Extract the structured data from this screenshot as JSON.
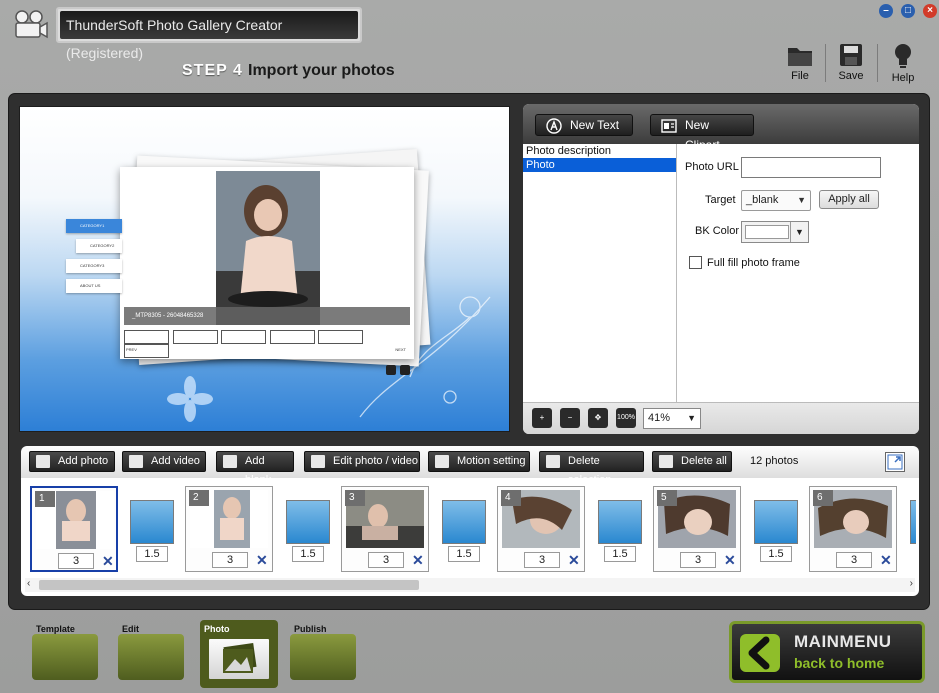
{
  "window": {
    "title": "ThunderSoft Photo Gallery Creator (Registered)",
    "controls": {
      "minimize": "minimize-icon",
      "maximize": "maximize-icon",
      "close": "close-icon"
    }
  },
  "step": {
    "label": "STEP 4",
    "title": "Import your photos"
  },
  "tools": {
    "file": "File",
    "save": "Save",
    "help": "Help"
  },
  "preview": {
    "menu": [
      "CATEGORY1",
      "CATEGORY2",
      "CATEGORY3",
      "ABOUT US"
    ],
    "caption": "_MTP8305 - 26048465328",
    "prev": "PREV",
    "next": "NEXT"
  },
  "props": {
    "new_text": "New Text",
    "new_clipart": "New Clipart",
    "list": [
      "Photo description",
      "Photo"
    ],
    "selected_index": 1,
    "photo_url_label": "Photo URL",
    "photo_url_value": "",
    "target_label": "Target",
    "target_value": "_blank",
    "apply_all": "Apply all",
    "bkcolor_label": "BK Color",
    "fullfill_label": "Full fill photo frame",
    "fullfill_checked": false,
    "zoom_value": "41%",
    "zoom_100_label": "100%"
  },
  "strip_toolbar": {
    "add_photo": "Add photo",
    "add_video": "Add video",
    "add_blank": "Add blank",
    "edit_photo_video": "Edit photo / video",
    "motion_setting": "Motion setting",
    "delete_selection": "Delete selection",
    "delete_all": "Delete all",
    "photo_count": "12 photos"
  },
  "thumbnails": [
    {
      "num": "1",
      "duration": "3",
      "transition": "1.5"
    },
    {
      "num": "2",
      "duration": "3",
      "transition": "1.5"
    },
    {
      "num": "3",
      "duration": "3",
      "transition": "1.5"
    },
    {
      "num": "4",
      "duration": "3",
      "transition": "1.5"
    },
    {
      "num": "5",
      "duration": "3",
      "transition": "1.5"
    },
    {
      "num": "6",
      "duration": "3"
    }
  ],
  "bottom_tabs": {
    "template": "Template",
    "edit": "Edit",
    "photo": "Photo",
    "publish": "Publish",
    "active": "photo"
  },
  "mainmenu": {
    "line1": "MAINMENU",
    "line2": "back to home"
  },
  "colors": {
    "accent_green": "#8fbe2a",
    "selection_blue": "#0a5fd8",
    "panel_dark": "#2f2f2f"
  }
}
